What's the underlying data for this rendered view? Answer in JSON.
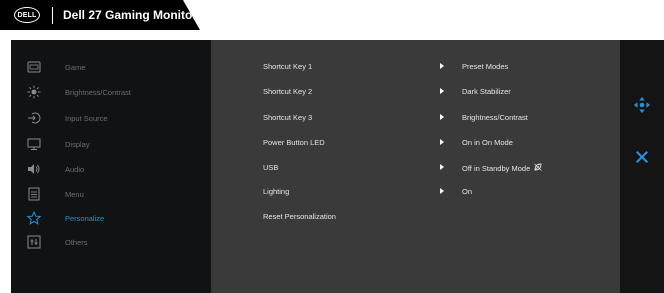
{
  "header": {
    "logo_text": "DELL",
    "title": "Dell 27 Gaming Monitor"
  },
  "sidebar": {
    "items": [
      {
        "label": "Game",
        "icon": "game-icon",
        "active": false
      },
      {
        "label": "Brightness/Contrast",
        "icon": "brightness-icon",
        "active": false
      },
      {
        "label": "Input Source",
        "icon": "input-source-icon",
        "active": false
      },
      {
        "label": "Display",
        "icon": "display-icon",
        "active": false
      },
      {
        "label": "Audio",
        "icon": "audio-icon",
        "active": false
      },
      {
        "label": "Menu",
        "icon": "menu-icon",
        "active": false
      },
      {
        "label": "Personalize",
        "icon": "star-icon",
        "active": true
      },
      {
        "label": "Others",
        "icon": "others-icon",
        "active": false
      }
    ]
  },
  "content": {
    "rows": [
      {
        "label": "Shortcut Key 1",
        "value": "Preset Modes"
      },
      {
        "label": "Shortcut Key 2",
        "value": "Dark Stabilizer"
      },
      {
        "label": "Shortcut Key 3",
        "value": "Brightness/Contrast"
      },
      {
        "label": "Power Button LED",
        "value": "On in On Mode"
      },
      {
        "label": "USB",
        "value": "Off in Standby Mode"
      },
      {
        "label": "Lighting",
        "value": "On"
      },
      {
        "label": "Reset Personalization",
        "value": ""
      }
    ]
  },
  "nav": {
    "move_icon": "move-arrows-icon",
    "close_icon": "close-icon"
  },
  "colors": {
    "accent": "#2b8fd8",
    "sidebar_bg": "#111213",
    "content_bg": "#3a3a3a",
    "header_bg": "#000000"
  }
}
